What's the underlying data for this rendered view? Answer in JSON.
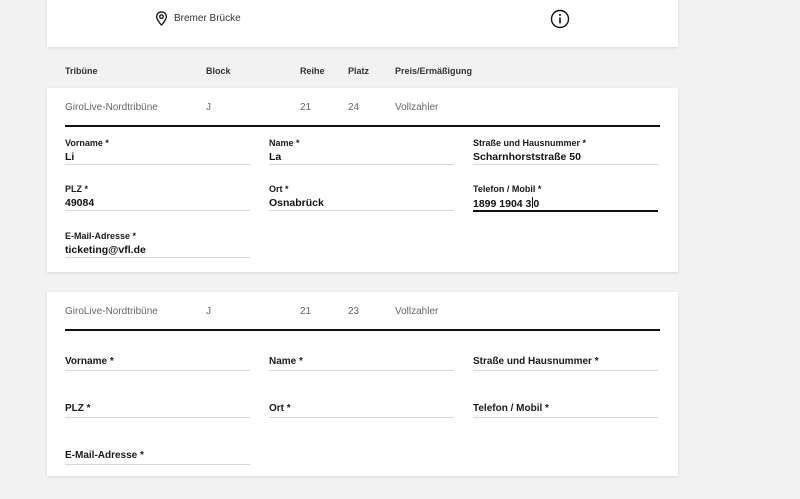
{
  "venue": {
    "name": "Bremer Brücke"
  },
  "columns": {
    "tribune": "Tribüne",
    "block": "Block",
    "row": "Reihe",
    "seat": "Platz",
    "price": "Preis/Ermäßigung"
  },
  "seats": [
    {
      "tribune": "GiroLive-Nordtribüne",
      "block": "J",
      "row": "21",
      "seat": "24",
      "price": "Vollzahler",
      "fields": {
        "vorname": {
          "label": "Vorname *",
          "value": "Li"
        },
        "name": {
          "label": "Name *",
          "value": "La"
        },
        "strasse": {
          "label": "Straße und Hausnummer *",
          "value": "Scharnhorststraße 50"
        },
        "plz": {
          "label": "PLZ *",
          "value": "49084"
        },
        "ort": {
          "label": "Ort *",
          "value": "Osnabrück"
        },
        "telefon": {
          "label": "Telefon / Mobil *",
          "value_before_caret": "1899 1904 3",
          "value_after_caret": "0"
        },
        "email": {
          "label": "E-Mail-Adresse *",
          "value": "ticketing@vfl.de"
        }
      }
    },
    {
      "tribune": "GiroLive-Nordtribüne",
      "block": "J",
      "row": "21",
      "seat": "23",
      "price": "Vollzahler",
      "fields": {
        "vorname": {
          "label": "Vorname *",
          "value": ""
        },
        "name": {
          "label": "Name *",
          "value": ""
        },
        "strasse": {
          "label": "Straße und Hausnummer *",
          "value": ""
        },
        "plz": {
          "label": "PLZ *",
          "value": ""
        },
        "ort": {
          "label": "Ort *",
          "value": ""
        },
        "telefon": {
          "label": "Telefon / Mobil *",
          "value": ""
        },
        "email": {
          "label": "E-Mail-Adresse *",
          "value": ""
        }
      }
    }
  ],
  "colors": {
    "background": "#f2f2f2",
    "card": "#ffffff",
    "divider": "#111111",
    "field_line": "#d8d8d8"
  }
}
